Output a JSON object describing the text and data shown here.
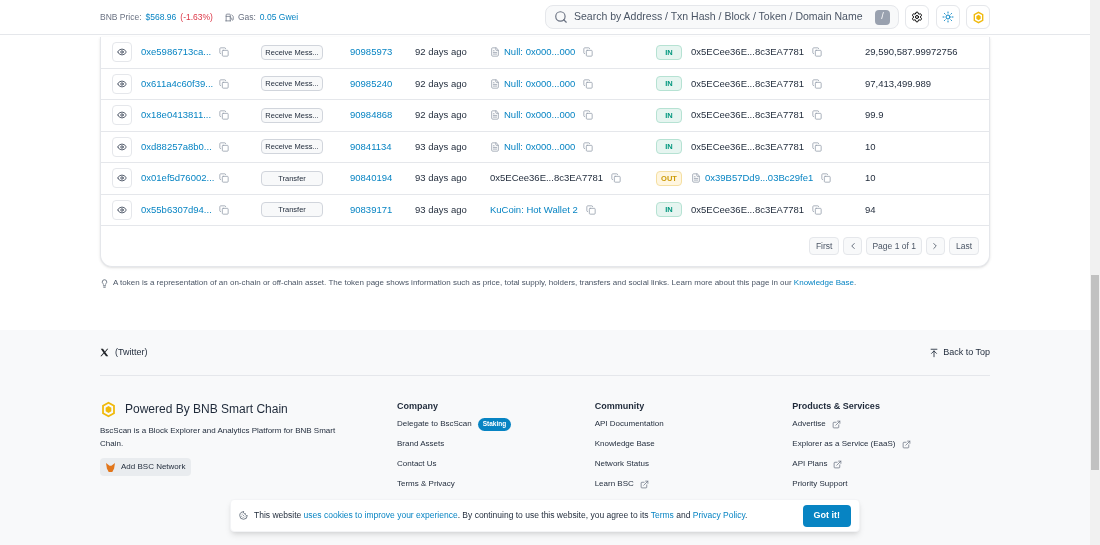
{
  "header": {
    "price_label": "BNB Price:",
    "price": "$568.96",
    "price_change": "(-1.63%)",
    "gas_label": "Gas:",
    "gas": "0.05 Gwei"
  },
  "search": {
    "placeholder": "Search by Address / Txn Hash / Block / Token / Domain Name",
    "shortcut": "/"
  },
  "table": {
    "rows": [
      {
        "hash": "0xe5986713ca...",
        "method": "Receive Mess...",
        "block": "90985973",
        "age": "92 days ago",
        "from": {
          "text": "Null: 0x000...000",
          "kind": "contract"
        },
        "direction": "IN",
        "to": {
          "text": "0x5ECee36E...8c3EA7781",
          "kind": "address"
        },
        "amount": "29,590,587.99972756"
      },
      {
        "hash": "0x611a4c60f39...",
        "method": "Receive Mess...",
        "block": "90985240",
        "age": "92 days ago",
        "from": {
          "text": "Null: 0x000...000",
          "kind": "contract"
        },
        "direction": "IN",
        "to": {
          "text": "0x5ECee36E...8c3EA7781",
          "kind": "address"
        },
        "amount": "97,413,499.989"
      },
      {
        "hash": "0x18e0413811...",
        "method": "Receive Mess...",
        "block": "90984868",
        "age": "92 days ago",
        "from": {
          "text": "Null: 0x000...000",
          "kind": "contract"
        },
        "direction": "IN",
        "to": {
          "text": "0x5ECee36E...8c3EA7781",
          "kind": "address"
        },
        "amount": "99.9"
      },
      {
        "hash": "0xd88257a8b0...",
        "method": "Receive Mess...",
        "block": "90841134",
        "age": "93 days ago",
        "from": {
          "text": "Null: 0x000...000",
          "kind": "contract"
        },
        "direction": "IN",
        "to": {
          "text": "0x5ECee36E...8c3EA7781",
          "kind": "address"
        },
        "amount": "10"
      },
      {
        "hash": "0x01ef5d76002...",
        "method": "Transfer",
        "block": "90840194",
        "age": "93 days ago",
        "from": {
          "text": "0x5ECee36E...8c3EA7781",
          "kind": "address"
        },
        "direction": "OUT",
        "to": {
          "text": "0x39B57Dd9...03Bc29fe1",
          "kind": "contract"
        },
        "amount": "10"
      },
      {
        "hash": "0x55b6307d94...",
        "method": "Transfer",
        "block": "90839171",
        "age": "93 days ago",
        "from": {
          "text": "KuCoin: Hot Wallet 2",
          "kind": "label"
        },
        "direction": "IN",
        "to": {
          "text": "0x5ECee36E...8c3EA7781",
          "kind": "address"
        },
        "amount": "94"
      }
    ]
  },
  "pagination": {
    "first": "First",
    "page": "Page 1 of 1",
    "last": "Last"
  },
  "note": {
    "text": "A token is a representation of an on-chain or off-chain asset. The token page shows information such as price, total supply, holders, transfers and social links. Learn more about this page in our ",
    "link": "Knowledge Base",
    "after": "."
  },
  "footer": {
    "social": "(Twitter)",
    "back_to_top": "Back to Top",
    "brand": {
      "title": "Powered By BNB Smart Chain",
      "description": "BscScan is a Block Explorer and Analytics Platform for BNB Smart Chain.",
      "button": "Add BSC Network"
    },
    "columns": [
      {
        "heading": "Company",
        "links": [
          {
            "text": "Delegate to BscScan",
            "external": false,
            "badge": "Staking"
          },
          {
            "text": "Brand Assets",
            "external": false
          },
          {
            "text": "Contact Us",
            "external": false
          },
          {
            "text": "Terms & Privacy",
            "external": false
          }
        ]
      },
      {
        "heading": "Community",
        "links": [
          {
            "text": "API Documentation",
            "external": false
          },
          {
            "text": "Knowledge Base",
            "external": false
          },
          {
            "text": "Network Status",
            "external": false
          },
          {
            "text": "Learn BSC",
            "external": true
          }
        ]
      },
      {
        "heading": "Products & Services",
        "links": [
          {
            "text": "Advertise",
            "external": true
          },
          {
            "text": "Explorer as a Service (EaaS)",
            "external": true
          },
          {
            "text": "API Plans",
            "external": true
          },
          {
            "text": "Priority Support",
            "external": false
          }
        ]
      }
    ]
  },
  "cookie": {
    "segments": [
      {
        "kind": "text",
        "text": "This website "
      },
      {
        "kind": "link",
        "text": "uses cookies to improve your experience"
      },
      {
        "kind": "text",
        "text": ". By continuing to use this website, you agree to its "
      },
      {
        "kind": "link",
        "text": "Terms"
      },
      {
        "kind": "text",
        "text": " and "
      },
      {
        "kind": "link",
        "text": "Privacy Policy"
      },
      {
        "kind": "text",
        "text": "."
      }
    ],
    "button": "Got it!"
  }
}
